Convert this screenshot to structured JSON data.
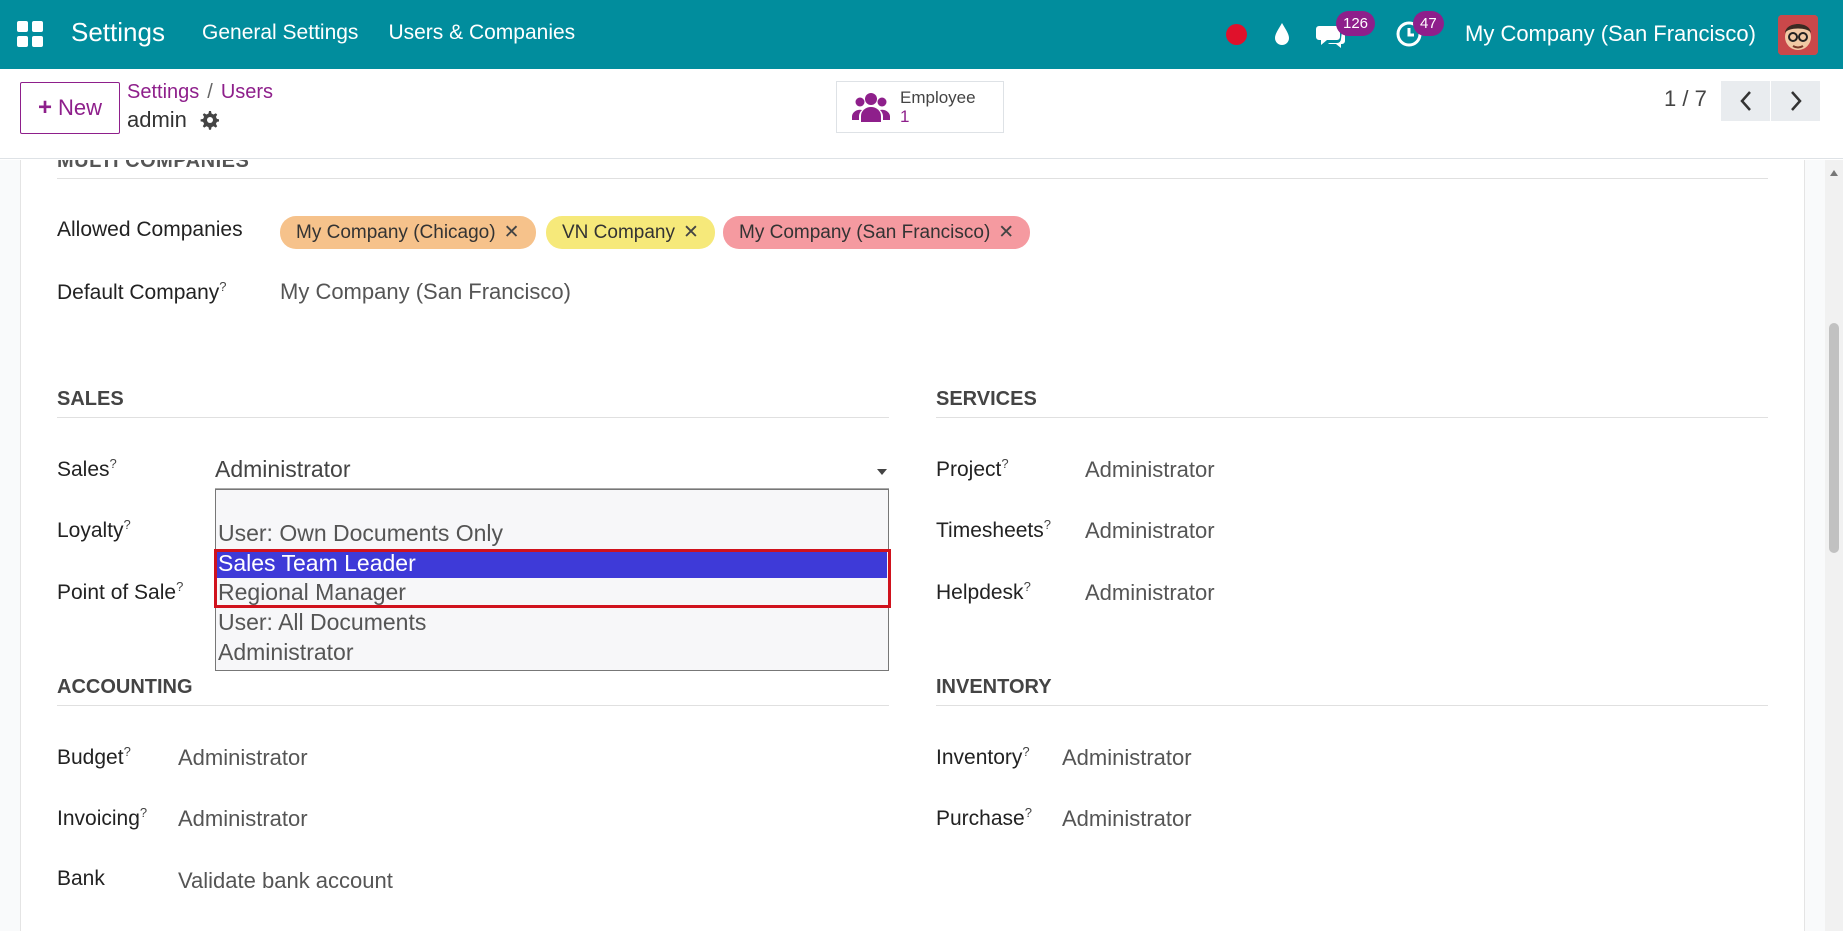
{
  "navbar": {
    "app_title": "Settings",
    "menu": [
      "General Settings",
      "Users & Companies"
    ],
    "chat_count": "126",
    "activity_count": "47",
    "company": "My Company (San Francisco)"
  },
  "control_panel": {
    "new_label": "New",
    "breadcrumb": [
      "Settings",
      "Users"
    ],
    "breadcrumb_sep": "/",
    "record_name": "admin",
    "smart_button": {
      "label": "Employee",
      "value": "1"
    },
    "pager": "1 / 7"
  },
  "form": {
    "cut_heading": "MULTI COMPANIES",
    "allowed_companies": {
      "label": "Allowed Companies",
      "tags": [
        "My Company (Chicago)",
        "VN Company",
        "My Company (San Francisco)"
      ]
    },
    "default_company": {
      "label": "Default Company",
      "help": "?",
      "value": "My Company (San Francisco)"
    },
    "sales_section": {
      "title": "SALES",
      "sales": {
        "label": "Sales",
        "help": "?",
        "value": "Administrator"
      },
      "loyalty": {
        "label": "Loyalty",
        "help": "?"
      },
      "pos": {
        "label": "Point of Sale",
        "help": "?"
      }
    },
    "dropdown_options": [
      "",
      "User: Own Documents Only",
      "Sales Team Leader",
      "Regional Manager",
      "User: All Documents",
      "Administrator"
    ],
    "services_section": {
      "title": "SERVICES",
      "project": {
        "label": "Project",
        "help": "?",
        "value": "Administrator"
      },
      "timesheets": {
        "label": "Timesheets",
        "help": "?",
        "value": "Administrator"
      },
      "helpdesk": {
        "label": "Helpdesk",
        "help": "?",
        "value": "Administrator"
      }
    },
    "accounting_section": {
      "title": "ACCOUNTING",
      "budget": {
        "label": "Budget",
        "help": "?",
        "value": "Administrator"
      },
      "invoicing": {
        "label": "Invoicing",
        "help": "?",
        "value": "Administrator"
      },
      "bank": {
        "label": "Bank",
        "value": "Validate bank account"
      }
    },
    "inventory_section": {
      "title": "INVENTORY",
      "inventory": {
        "label": "Inventory",
        "help": "?",
        "value": "Administrator"
      },
      "purchase": {
        "label": "Purchase",
        "help": "?",
        "value": "Administrator"
      }
    }
  },
  "colors": {
    "navbar": "#018d9d",
    "primary": "#8e1f8b",
    "dropdown_selected": "#3e3ad8",
    "highlight": "#d0121d"
  }
}
